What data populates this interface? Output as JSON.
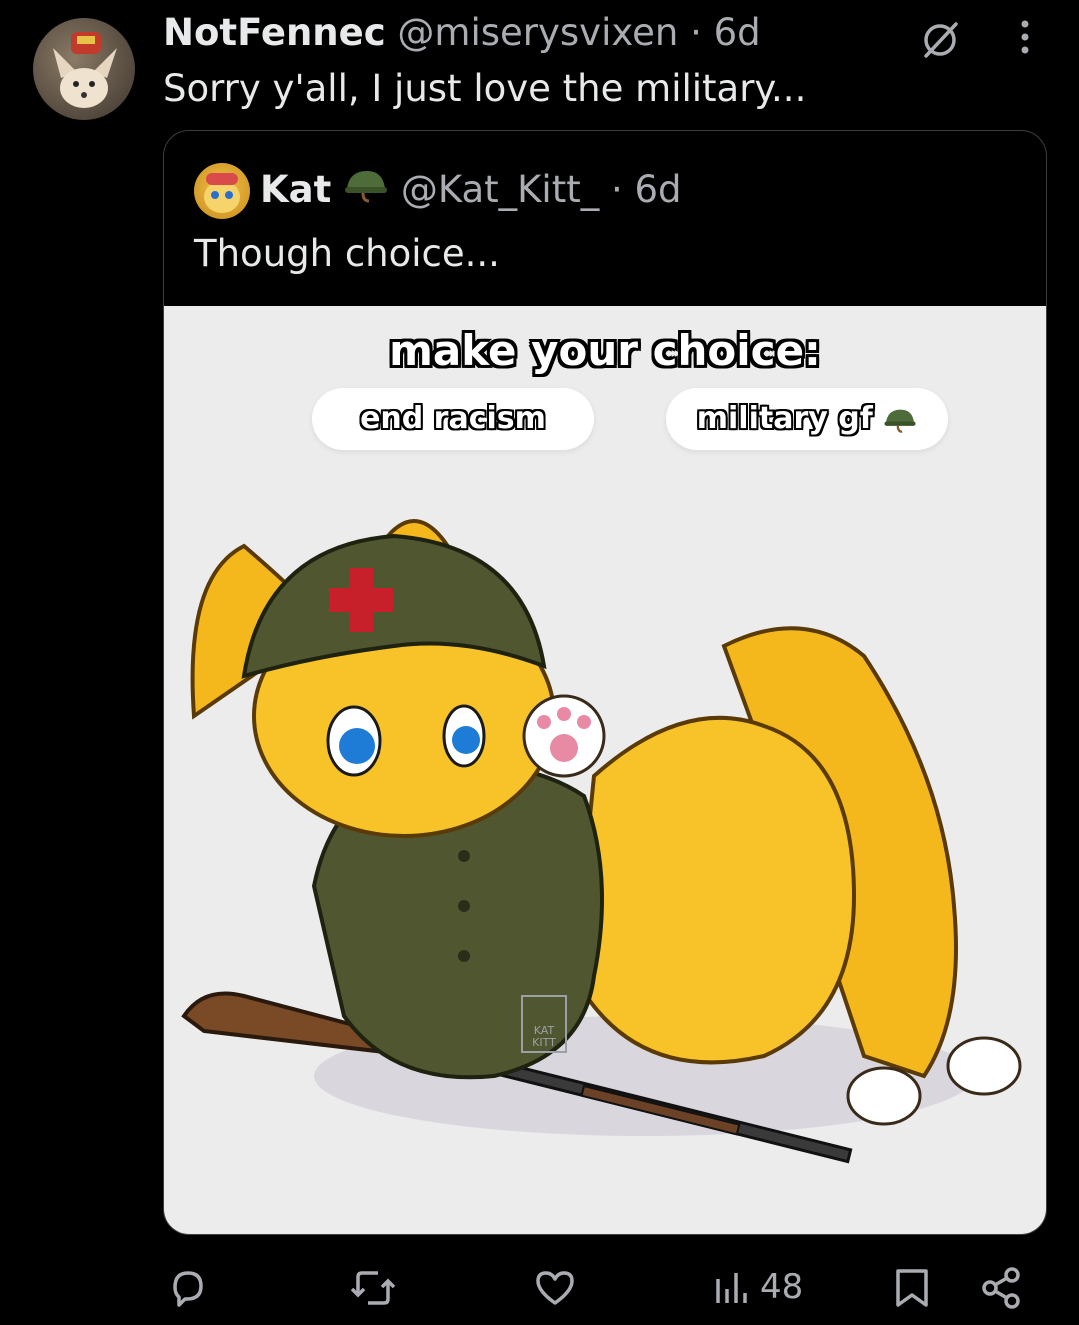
{
  "post": {
    "author_name": "NotFennec",
    "author_handle": "@miserysvixen",
    "separator": "·",
    "time": "6d",
    "text": "Sorry y'all, I just love the military..."
  },
  "quoted": {
    "author_name": "Kat",
    "author_handle": "@Kat_Kitt_",
    "separator": "·",
    "time": "6d",
    "text": "Though choice...",
    "media": {
      "title": "make your choice:",
      "choice_left": "end racism",
      "choice_right": "military gf",
      "watermark_line1": "KAT",
      "watermark_line2": "KITT"
    }
  },
  "actions": {
    "views": "48"
  },
  "icons": {
    "verified_badge": "helmet-icon",
    "grok": "slashed-circle-icon",
    "more": "more-vertical-icon",
    "reply": "reply-icon",
    "repost": "repost-icon",
    "like": "heart-icon",
    "views": "views-chart-icon",
    "bookmark": "bookmark-icon",
    "share": "share-icon"
  }
}
